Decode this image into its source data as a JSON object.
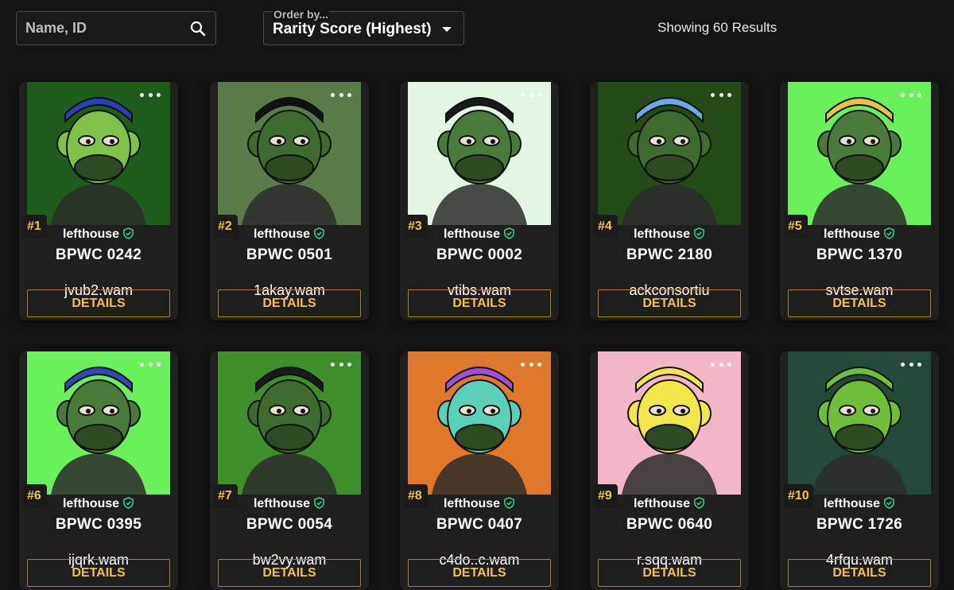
{
  "search": {
    "placeholder": "Name, ID",
    "value": "",
    "icon": "search-icon"
  },
  "order_by": {
    "label": "Order by...",
    "value": "Rarity Score (Highest)",
    "icon": "caret-down-icon"
  },
  "results_text": "Showing 60 Results",
  "card_common": {
    "details_label": "DETAILS",
    "more_icon": "more-dots-icon",
    "verified_icon": "verified-shield-icon"
  },
  "colors": {
    "accent": "#f1c24a",
    "verified": "#3ccf8e",
    "background": "#141414",
    "card": "#1f1f1f"
  },
  "cards": [
    {
      "rank": "#1",
      "owner": "lefthouse",
      "title": "BPWC 0242",
      "wallet": "jvub2.wam",
      "bg": "#1d5c1a",
      "skin": "#7fc24a",
      "hat": "#2a3fb8"
    },
    {
      "rank": "#2",
      "owner": "lefthouse",
      "title": "BPWC 0501",
      "wallet": "1akay.wam",
      "bg": "#5b7a4a",
      "skin": "#3f6b2e",
      "hat": "#111111"
    },
    {
      "rank": "#3",
      "owner": "lefthouse",
      "title": "BPWC 0002",
      "wallet": "vtibs.wam",
      "bg": "#e3f5e3",
      "skin": "#4a7a3a",
      "hat": "#1a1a1a"
    },
    {
      "rank": "#4",
      "owner": "lefthouse",
      "title": "BPWC 2180",
      "wallet": "ackconsortiu",
      "bg": "#244a18",
      "skin": "#3f6b2e",
      "hat": "#6fa7e6"
    },
    {
      "rank": "#5",
      "owner": "lefthouse",
      "title": "BPWC 1370",
      "wallet": "svtse.wam",
      "bg": "#6af05a",
      "skin": "#4a7a3a",
      "hat": "#e8c04a"
    },
    {
      "rank": "#6",
      "owner": "lefthouse",
      "title": "BPWC 0395",
      "wallet": "ijqrk.wam",
      "bg": "#6af05a",
      "skin": "#4a7a3a",
      "hat": "#2b4ab8"
    },
    {
      "rank": "#7",
      "owner": "lefthouse",
      "title": "BPWC 0054",
      "wallet": "bw2vy.wam",
      "bg": "#3e8f2a",
      "skin": "#3f6b2e",
      "hat": "#1a1a1a"
    },
    {
      "rank": "#8",
      "owner": "lefthouse",
      "title": "BPWC 0407",
      "wallet": "c4do..c.wam",
      "bg": "#e0782c",
      "skin": "#5ad0b8",
      "hat": "#a24de0"
    },
    {
      "rank": "#9",
      "owner": "lefthouse",
      "title": "BPWC 0640",
      "wallet": "r.sqq.wam",
      "bg": "#f2b6c6",
      "skin": "#f0e84a",
      "hat": "#f0e84a"
    },
    {
      "rank": "#10",
      "owner": "lefthouse",
      "title": "BPWC 1726",
      "wallet": "4rfqu.wam",
      "bg": "#234a38",
      "skin": "#6fbf3a",
      "hat": "#6fbf3a"
    }
  ]
}
